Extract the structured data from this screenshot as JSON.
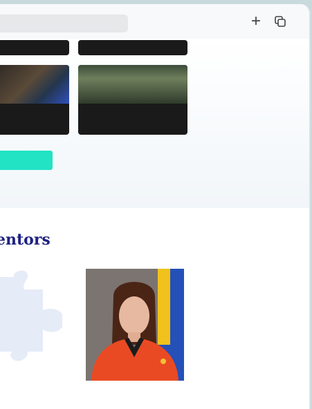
{
  "browser": {
    "url_placeholder": "",
    "new_tab_icon": "plus-icon",
    "tabs_icon": "copy-tabs-icon"
  },
  "news": {
    "cards": [
      {
        "title": ""
      },
      {
        "title": ""
      },
      {
        "title": ""
      },
      {
        "title": ""
      }
    ],
    "cta_label": ""
  },
  "mentors": {
    "title": "entors",
    "people": [
      {
        "name": "",
        "role": ""
      },
      {
        "name": "",
        "role": ""
      }
    ]
  },
  "colors": {
    "accent": "#23e3c5",
    "heading": "#1f2280",
    "name": "#20c5b2"
  }
}
